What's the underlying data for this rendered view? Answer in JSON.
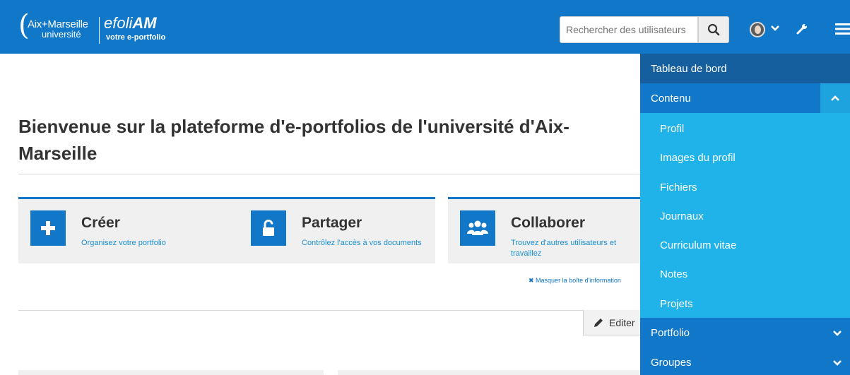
{
  "header": {
    "logo_line1": "Aix+Marseille",
    "logo_line2": "université",
    "brand_light": "efoli",
    "brand_bold": "AM",
    "tagline": "votre e-portfolio",
    "search_placeholder": "Rechercher des utilisateurs"
  },
  "main": {
    "title": "Bienvenue sur la plateforme d'e-portfolios de l'université d'Aix-Marseille",
    "cards": [
      {
        "title": "Créer",
        "desc": "Organisez votre portfolio",
        "icon": "plus-icon"
      },
      {
        "title": "Partager",
        "desc": "Contrôlez l'accès à vos documents",
        "icon": "unlock-icon"
      },
      {
        "title": "Collaborer",
        "desc": "Trouvez d'autres utilisateurs et travaillez",
        "icon": "users-icon"
      }
    ],
    "hide_info": "Masquer la boîte d'information",
    "edit_label": "Editer"
  },
  "menu": {
    "dashboard": "Tableau de bord",
    "content": "Contenu",
    "content_items": [
      "Profil",
      "Images du profil",
      "Fichiers",
      "Journaux",
      "Curriculum vitae",
      "Notes",
      "Projets"
    ],
    "portfolio": "Portfolio",
    "groups": "Groupes"
  },
  "colors": {
    "header_blue": "#1177c8",
    "menu_dark": "#155f9e",
    "submenu_cyan": "#1fb3ea",
    "link_blue": "#1a8fd6"
  }
}
